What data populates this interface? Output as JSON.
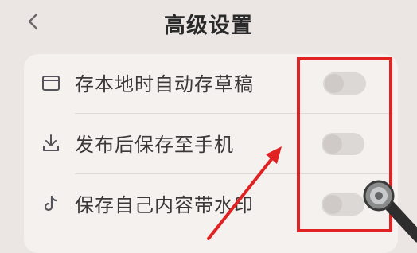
{
  "header": {
    "title": "高级设置",
    "back_icon": "chevron-left-icon"
  },
  "settings": [
    {
      "label": "存本地时自动存草稿",
      "icon": "draft-icon",
      "enabled": false
    },
    {
      "label": "发布后保存至手机",
      "icon": "download-icon",
      "enabled": false
    },
    {
      "label": "保存自己内容带水印",
      "icon": "tiktok-icon",
      "enabled": false
    }
  ],
  "annotation": {
    "highlight_color": "#e02222",
    "arrow_color": "#e02222"
  }
}
